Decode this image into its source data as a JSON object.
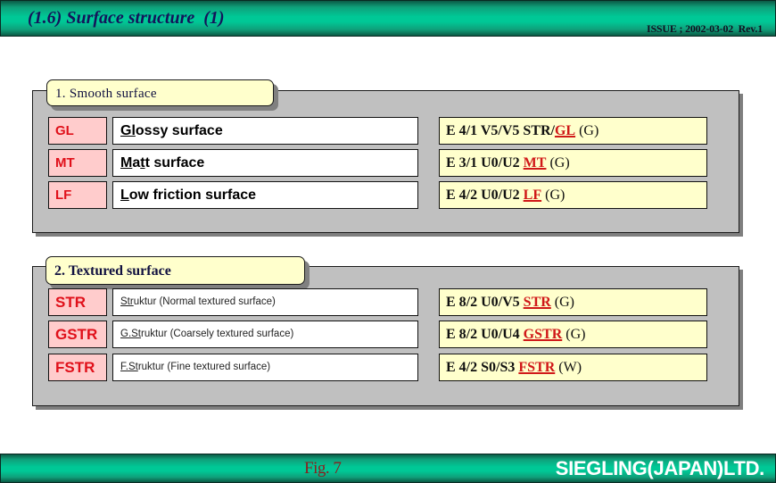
{
  "header": {
    "title": "(1.6) Surface structure  (1)",
    "issue": "ISSUE ; 2002-03-02  Rev.1"
  },
  "footer": {
    "figure": "Fig. 7",
    "company": "SIEGLING(JAPAN)LTD."
  },
  "colors": {
    "bar_teal": "#00c896",
    "panel_gray": "#c0c0c0",
    "label_yellow": "#ffffcc",
    "code_pink": "#ffcccc",
    "code_red": "#e0101a"
  },
  "sections": [
    {
      "label": "1. Smooth surface",
      "rows": [
        {
          "code": "GL",
          "desc_underlined": "Gl",
          "desc_rest": "ossy surface",
          "spec_prefix": "E 4/1 V5/V5 STR/",
          "spec_highlight": "GL",
          "spec_suffix": " (G)"
        },
        {
          "code": "MT",
          "desc_underlined": "M",
          "desc_mid": "a",
          "desc_underlined2": "t",
          "desc_rest": "t surface",
          "spec_prefix": "E 3/1 U0/U2 ",
          "spec_highlight": "MT",
          "spec_suffix": " (G)"
        },
        {
          "code": "LF",
          "desc_underlined": "L",
          "desc_rest": "ow friction surface",
          "spec_prefix": "E 4/2 U0/U2 ",
          "spec_highlight": "LF",
          "spec_suffix": " (G)"
        }
      ]
    },
    {
      "label": "2. Textured surface",
      "rows": [
        {
          "code": "STR",
          "desc_underlined": "Str",
          "desc_rest": "uktur (Normal textured surface)",
          "spec_prefix": "E 8/2 U0/V5 ",
          "spec_highlight": "STR",
          "spec_suffix": " (G)"
        },
        {
          "code": "GSTR",
          "desc_underlined": "G.St",
          "desc_rest": "ruktur (Coarsely textured surface)",
          "spec_prefix": "E 8/2 U0/U4 ",
          "spec_highlight": "GSTR",
          "spec_suffix": " (G)"
        },
        {
          "code": "FSTR",
          "desc_underlined": "F.St",
          "desc_rest": "ruktur (Fine textured surface)",
          "spec_prefix": "E 4/2 S0/S3 ",
          "spec_highlight": "FSTR",
          "spec_suffix": " (W)"
        }
      ]
    }
  ]
}
